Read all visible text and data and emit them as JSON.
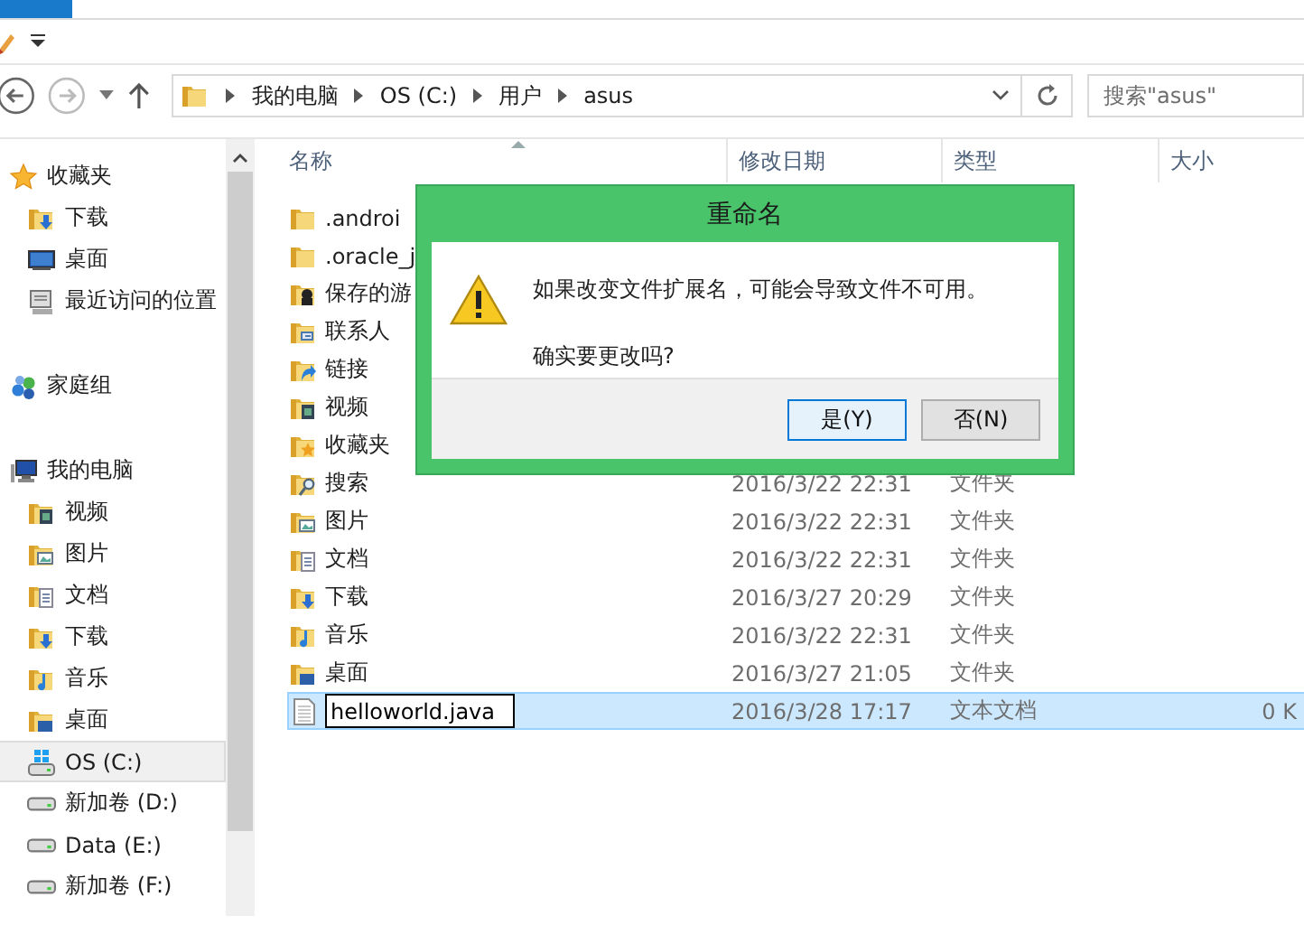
{
  "address_bar": {
    "crumbs": [
      "我的电脑",
      "OS (C:)",
      "用户",
      "asus"
    ]
  },
  "search": {
    "placeholder": "搜索\"asus\""
  },
  "sidebar": {
    "items": [
      {
        "label": "收藏夹",
        "kind": "star",
        "selected": false,
        "children": [
          {
            "label": "下载",
            "kind": "folder-download",
            "selected": false
          },
          {
            "label": "桌面",
            "kind": "monitor",
            "selected": false
          },
          {
            "label": "最近访问的位置",
            "kind": "recent",
            "selected": false
          }
        ]
      },
      {
        "label": "家庭组",
        "kind": "homegroup",
        "selected": false
      },
      {
        "label": "我的电脑",
        "kind": "computer",
        "selected": false,
        "children": [
          {
            "label": "视频",
            "kind": "folder-video",
            "selected": false
          },
          {
            "label": "图片",
            "kind": "folder-picture",
            "selected": false
          },
          {
            "label": "文档",
            "kind": "folder-document",
            "selected": false
          },
          {
            "label": "下载",
            "kind": "folder-download",
            "selected": false
          },
          {
            "label": "音乐",
            "kind": "folder-music",
            "selected": false
          },
          {
            "label": "桌面",
            "kind": "folder-desktop",
            "selected": false
          },
          {
            "label": "OS (C:)",
            "kind": "windrive",
            "selected": true
          },
          {
            "label": "新加卷 (D:)",
            "kind": "drive",
            "selected": false
          },
          {
            "label": "Data (E:)",
            "kind": "drive",
            "selected": false
          },
          {
            "label": "新加卷 (F:)",
            "kind": "drive",
            "selected": false
          }
        ]
      }
    ]
  },
  "columns": [
    "名称",
    "修改日期",
    "类型",
    "大小"
  ],
  "rows": [
    {
      "name": ".androi",
      "kind": "folder",
      "selected": false
    },
    {
      "name": ".oracle_j",
      "kind": "folder",
      "selected": false
    },
    {
      "name": "保存的游",
      "kind": "folder-game",
      "selected": false
    },
    {
      "name": "联系人",
      "kind": "folder-contact",
      "selected": false
    },
    {
      "name": "链接",
      "kind": "folder-link",
      "selected": false
    },
    {
      "name": "视频",
      "kind": "folder-video",
      "selected": false
    },
    {
      "name": "收藏夹",
      "kind": "folder-star",
      "selected": false
    },
    {
      "name": "搜索",
      "kind": "folder-search",
      "date": "2016/3/22 22:31",
      "type": "文件夹",
      "selected": false
    },
    {
      "name": "图片",
      "kind": "folder-picture",
      "date": "2016/3/22 22:31",
      "type": "文件夹",
      "selected": false
    },
    {
      "name": "文档",
      "kind": "folder-document",
      "date": "2016/3/22 22:31",
      "type": "文件夹",
      "selected": false
    },
    {
      "name": "下载",
      "kind": "folder-download",
      "date": "2016/3/27 20:29",
      "type": "文件夹",
      "selected": false
    },
    {
      "name": "音乐",
      "kind": "folder-music",
      "date": "2016/3/22 22:31",
      "type": "文件夹",
      "selected": false
    },
    {
      "name": "桌面",
      "kind": "folder-desktop",
      "date": "2016/3/27 21:05",
      "type": "文件夹",
      "selected": false
    },
    {
      "name": "helloworld.java",
      "kind": "textfile",
      "date": "2016/3/28 17:17",
      "type": "文本文档",
      "size": "0 K",
      "selected": true,
      "editing": true
    }
  ],
  "dialog": {
    "title": "重命名",
    "message": "如果改变文件扩展名，可能会导致文件不可用。",
    "question": "确实要更改吗?",
    "buttons": [
      {
        "label": "是(Y)",
        "selected": true
      },
      {
        "label": "否(N)",
        "selected": false
      }
    ]
  }
}
